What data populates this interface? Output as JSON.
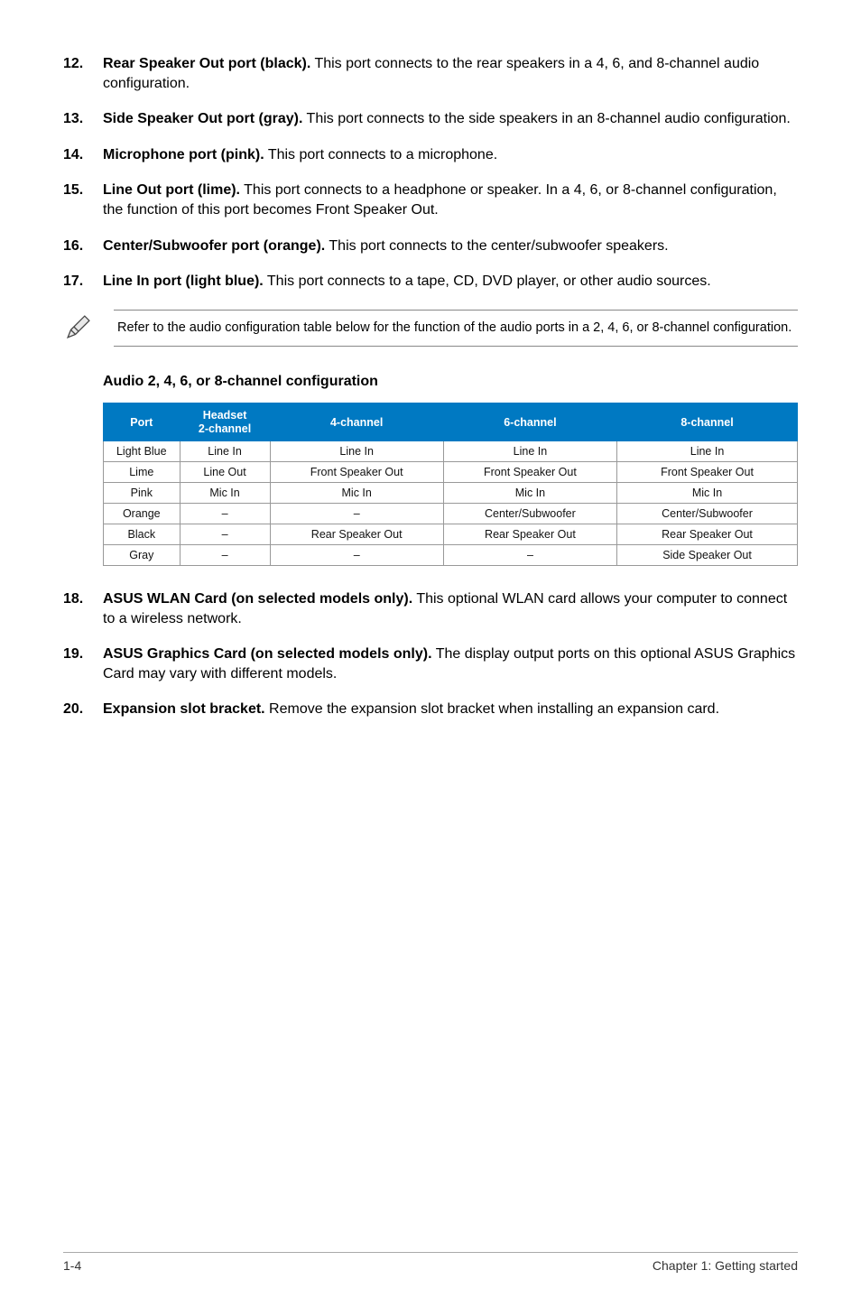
{
  "items_top": [
    {
      "num": "12.",
      "bold": "Rear Speaker Out port (black).",
      "text": " This port connects to the rear speakers in a 4, 6, and 8-channel audio configuration."
    },
    {
      "num": "13.",
      "bold": "Side Speaker Out port (gray).",
      "text": " This port connects to the side speakers in an 8-channel audio configuration."
    },
    {
      "num": "14.",
      "bold": "Microphone port (pink).",
      "text": " This port connects to a microphone."
    },
    {
      "num": "15.",
      "bold": "Line Out port (lime).",
      "text": " This port connects to a headphone or speaker. In a 4, 6, or 8-channel configuration, the function of this port becomes Front Speaker Out."
    },
    {
      "num": "16.",
      "bold": "Center/Subwoofer port (orange).",
      "text": " This port connects to the center/subwoofer speakers."
    },
    {
      "num": "17.",
      "bold": "Line In port (light blue).",
      "text": " This port connects to a tape, CD, DVD player, or other audio sources."
    }
  ],
  "note": "Refer to the audio configuration table below for the function of the audio ports in a 2, 4, 6, or 8-channel configuration.",
  "table_title": "Audio 2, 4, 6, or 8-channel configuration",
  "table": {
    "headers": [
      "Port",
      "Headset\n2-channel",
      "4-channel",
      "6-channel",
      "8-channel"
    ],
    "rows": [
      [
        "Light Blue",
        "Line In",
        "Line In",
        "Line In",
        "Line In"
      ],
      [
        "Lime",
        "Line Out",
        "Front Speaker Out",
        "Front Speaker Out",
        "Front Speaker Out"
      ],
      [
        "Pink",
        "Mic In",
        "Mic In",
        "Mic In",
        "Mic In"
      ],
      [
        "Orange",
        "–",
        "–",
        "Center/Subwoofer",
        "Center/Subwoofer"
      ],
      [
        "Black",
        "–",
        "Rear Speaker Out",
        "Rear Speaker Out",
        "Rear Speaker Out"
      ],
      [
        "Gray",
        "–",
        "–",
        "–",
        "Side Speaker Out"
      ]
    ]
  },
  "items_bottom": [
    {
      "num": "18.",
      "bold": "ASUS WLAN Card (on selected models only).",
      "text": " This optional WLAN card allows your computer to connect to a wireless network."
    },
    {
      "num": "19.",
      "bold": "ASUS Graphics Card (on selected models only).",
      "text": " The display output ports on this optional ASUS Graphics Card may vary with different models."
    },
    {
      "num": "20.",
      "bold": "Expansion slot bracket.",
      "text": " Remove the expansion slot bracket when installing an expansion card."
    }
  ],
  "footer": {
    "left": "1-4",
    "right": "Chapter 1: Getting started"
  }
}
